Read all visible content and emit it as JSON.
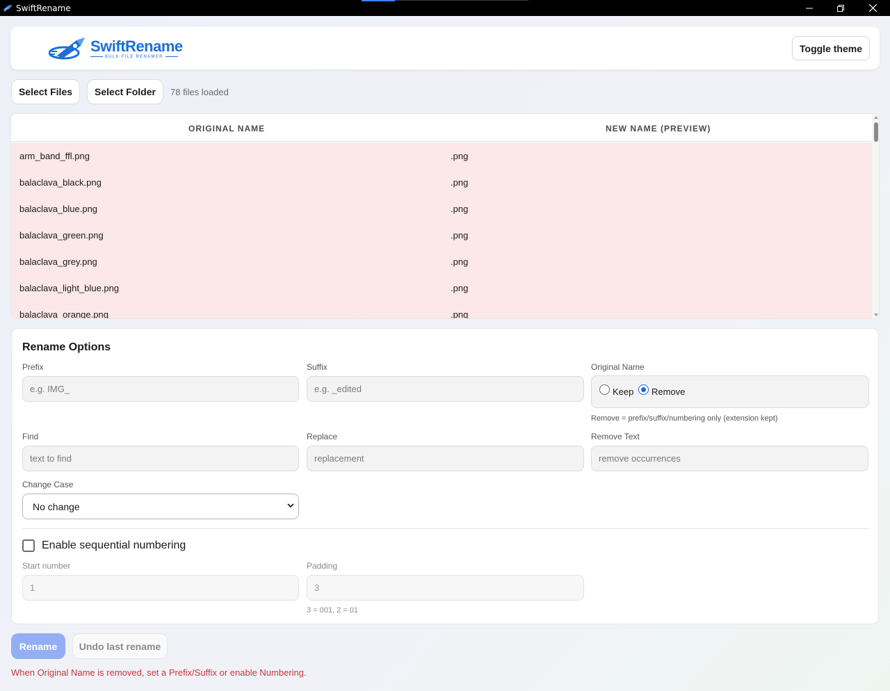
{
  "window": {
    "title": "SwiftRename"
  },
  "header": {
    "logo_main": "SwiftRename",
    "logo_sub": "BULK FILE RENAMER",
    "toggle_theme": "Toggle theme"
  },
  "files": {
    "select_files": "Select Files",
    "select_folder": "Select Folder",
    "loaded_text": "78 files loaded"
  },
  "table": {
    "col_original": "ORIGINAL NAME",
    "col_new": "NEW NAME (PREVIEW)",
    "rows": [
      {
        "original": "arm_band_ffl.png",
        "new": ".png"
      },
      {
        "original": "balaclava_black.png",
        "new": ".png"
      },
      {
        "original": "balaclava_blue.png",
        "new": ".png"
      },
      {
        "original": "balaclava_green.png",
        "new": ".png"
      },
      {
        "original": "balaclava_grey.png",
        "new": ".png"
      },
      {
        "original": "balaclava_light_blue.png",
        "new": ".png"
      },
      {
        "original": "balaclava_orange.png",
        "new": ".png"
      }
    ]
  },
  "options": {
    "title": "Rename Options",
    "prefix": {
      "label": "Prefix",
      "placeholder": "e.g. IMG_"
    },
    "suffix": {
      "label": "Suffix",
      "placeholder": "e.g. _edited"
    },
    "original_name": {
      "label": "Original Name",
      "keep": "Keep",
      "remove": "Remove",
      "selected": "Remove",
      "hint": "Remove = prefix/suffix/numbering only (extension kept)"
    },
    "find": {
      "label": "Find",
      "placeholder": "text to find"
    },
    "replace": {
      "label": "Replace",
      "placeholder": "replacement"
    },
    "remove_text": {
      "label": "Remove Text",
      "placeholder": "remove occurrences"
    },
    "change_case": {
      "label": "Change Case",
      "value": "No change"
    },
    "numbering": {
      "label": "Enable sequential numbering",
      "enabled": false,
      "start_label": "Start number",
      "start_placeholder": "1",
      "padding_label": "Padding",
      "padding_placeholder": "3",
      "padding_hint": "3 = 001, 2 = 01"
    }
  },
  "actions": {
    "rename": "Rename",
    "undo": "Undo last rename",
    "warning": "When Original Name is removed, set a Prefix/Suffix or enable Numbering."
  },
  "colors": {
    "accent": "#1a66e0",
    "row_error_bg": "#fde8e9",
    "warning_text": "#c9363e",
    "rename_disabled": "#93aef5"
  }
}
